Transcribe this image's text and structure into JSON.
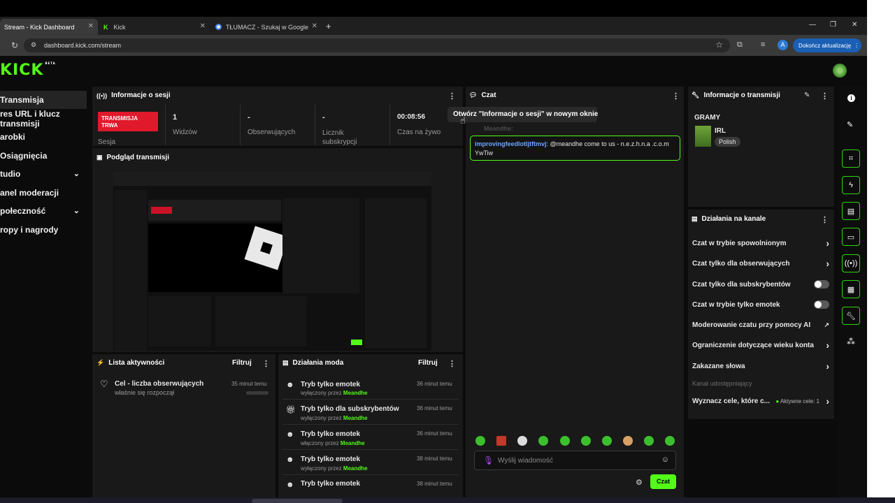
{
  "browser": {
    "tabs": [
      {
        "label": "Stream - Kick Dashboard"
      },
      {
        "label": "Kick"
      },
      {
        "label": "TŁUMACZ - Szukaj w Google"
      }
    ],
    "new_tab": "+",
    "url": "dashboard.kick.com/stream",
    "update_button": "Dokończ aktualizację",
    "profile_initial": "A",
    "window_controls": {
      "minimize": "—",
      "maximize": "❐",
      "close": "✕"
    }
  },
  "brand": {
    "logo": "KICK",
    "beta": "BETA",
    "color": "#53fc18"
  },
  "sidebar": {
    "items": [
      {
        "label": "Transmisja"
      },
      {
        "label": "res URL i klucz transmisji"
      },
      {
        "label": "arobki"
      },
      {
        "label": "Osiągnięcia"
      },
      {
        "label": "tudio"
      },
      {
        "label": "anel moderacji"
      },
      {
        "label": "połeczność"
      },
      {
        "label": "ropy i nagrody"
      }
    ]
  },
  "session": {
    "title": "Informacje o sesji",
    "status_badge": "TRANSMISJA TRWA",
    "status_label": "Sesja",
    "stats": [
      {
        "value": "1",
        "label": "Widzów"
      },
      {
        "value": "-",
        "label": "Obserwujących"
      },
      {
        "value": "-",
        "label": "Licznik subskrypcji"
      },
      {
        "value": "00:08:56",
        "label": "Czas na żywo"
      }
    ],
    "tooltip": "Otwórz \"Informacje o sesji\" w nowym oknie"
  },
  "preview": {
    "title": "Podgląd transmisji"
  },
  "activity": {
    "title": "Lista aktywności",
    "filter": "Filtruj",
    "items": [
      {
        "title": "Cel - liczba obserwujących",
        "sub": "właśnie się rozpoczął",
        "time": "35 minut temu"
      }
    ]
  },
  "modactions": {
    "title": "Działania moda",
    "filter": "Filtruj",
    "by_prefix_off": "wyłączony przez",
    "by_prefix_on": "włączony przez",
    "items": [
      {
        "title": "Tryb tylko emotek",
        "state": "wyłączony przez",
        "who": "Meandhe",
        "time": "36 minut temu"
      },
      {
        "title": "Tryb tylko dla subskrybentów",
        "state": "wyłączony przez",
        "who": "Meandhe",
        "time": "36 minut temu"
      },
      {
        "title": "Tryb tylko emotek",
        "state": "włączony przez",
        "who": "Meandhe",
        "time": "36 minut temu"
      },
      {
        "title": "Tryb tylko emotek",
        "state": "wyłączony przez",
        "who": "Meandhe",
        "time": "38 minut temu"
      },
      {
        "title": "Tryb tylko emotek",
        "state": "",
        "who": "",
        "time": "38 minut temu"
      }
    ]
  },
  "chat": {
    "title": "Czat",
    "pinned_user": "Meandhe:",
    "message_user": "improvingfeedlotljtftmvj",
    "message_text": ": @meandhe come to us - n.e.z.h.n.a .c.o.m YwTiw",
    "placeholder": "Wyślij wiadomość",
    "send": "Czat"
  },
  "streaminfo": {
    "title": "Informacje o transmisji",
    "category_header": "GRAMY",
    "category": "IRL",
    "tag": "Polish"
  },
  "channel": {
    "title": "Działania na kanale",
    "items": [
      {
        "label": "Czat w trybie spowolnionym",
        "control": "arrow"
      },
      {
        "label": "Czat tylko dla obserwujących",
        "control": "arrow"
      },
      {
        "label": "Czat tylko dla subskrybentów",
        "control": "toggle"
      },
      {
        "label": "Czat w trybie tylko emotek",
        "control": "toggle"
      },
      {
        "label": "Moderowanie czatu przy pomocy AI",
        "control": "external"
      },
      {
        "label": "Ograniczenie dotyczące wieku konta",
        "control": "arrow"
      },
      {
        "label": "Zakazane słowa",
        "control": "arrow"
      }
    ],
    "shared_label": "Kanał udostępniający",
    "goal_label": "Wyznacz cele, które c...",
    "goal_active": "Aktywne cele: 1"
  }
}
